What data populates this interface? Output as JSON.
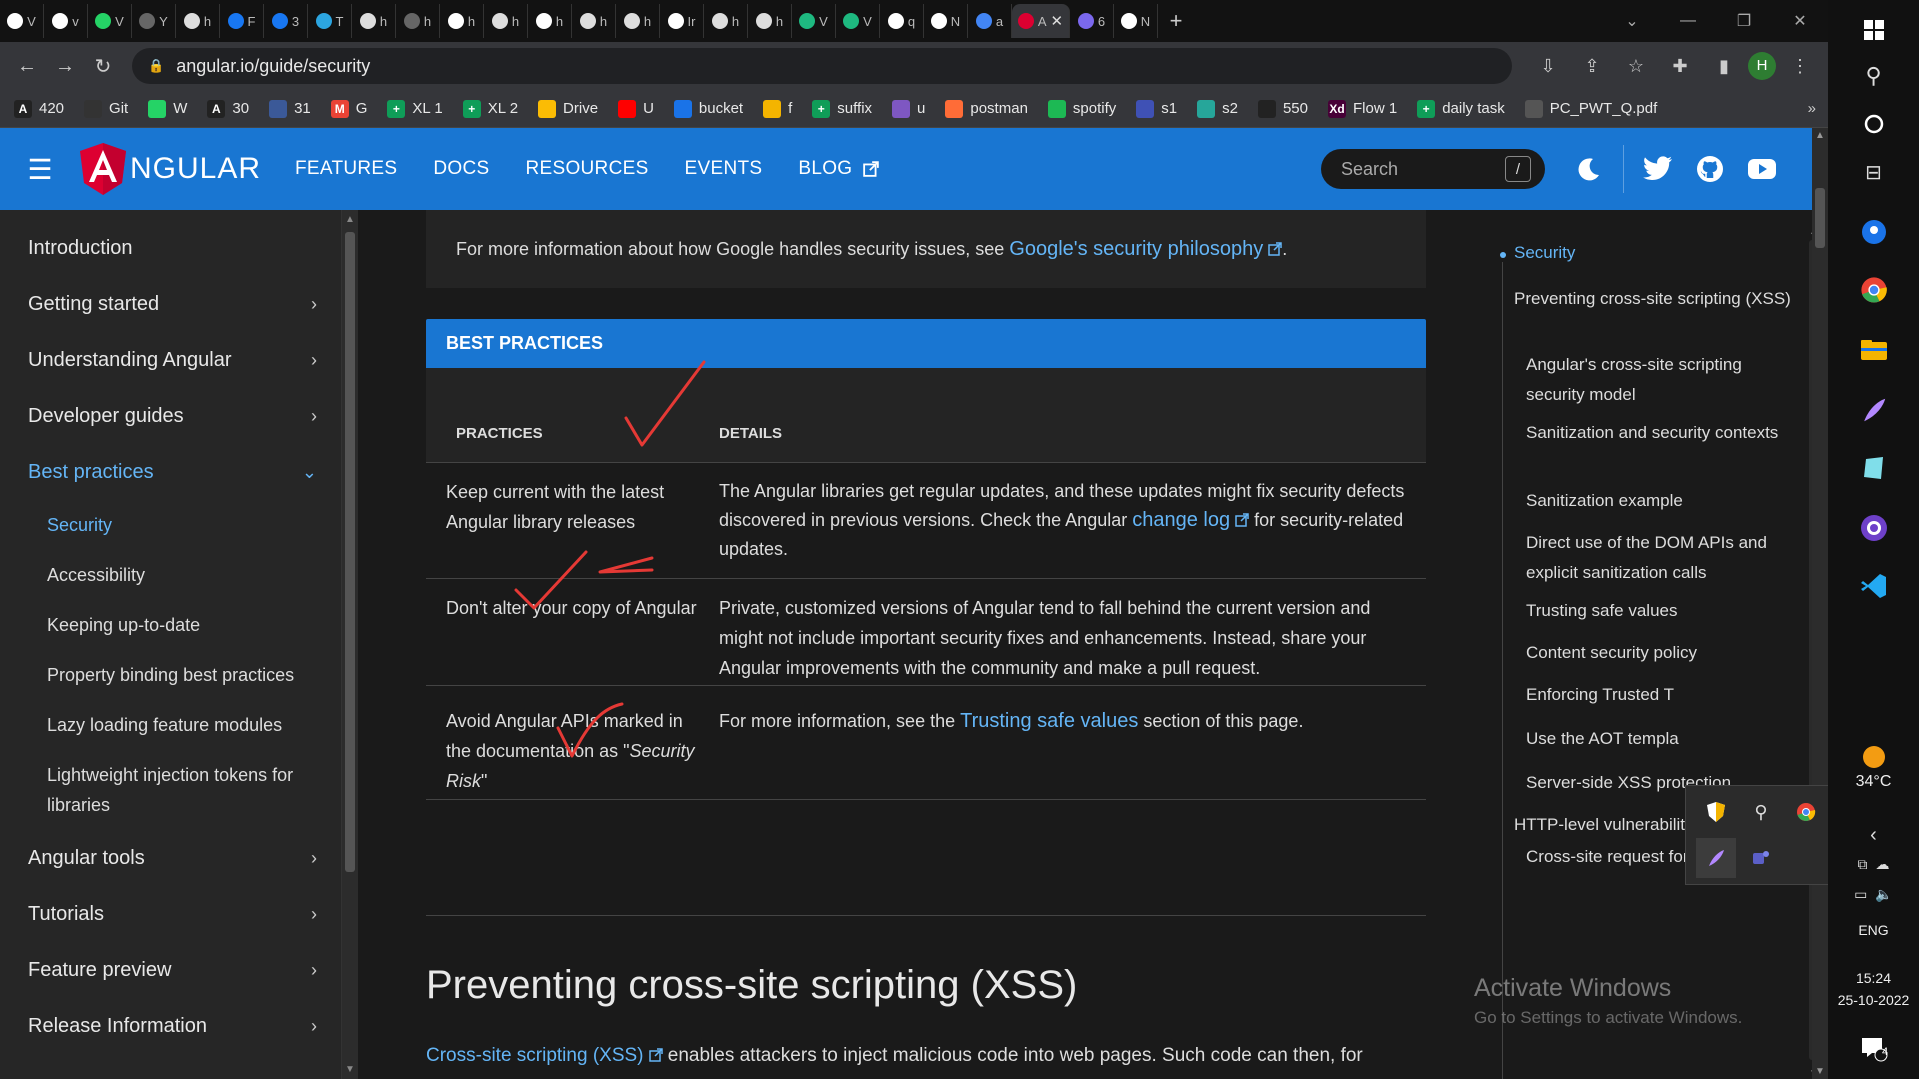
{
  "tabs": [
    {
      "label": "V",
      "color": "#ffffff"
    },
    {
      "label": "v",
      "color": "#ffffff"
    },
    {
      "label": "V",
      "color": "#25d366"
    },
    {
      "label": "Y",
      "color": "#666666"
    },
    {
      "label": "h",
      "color": "#dddddd"
    },
    {
      "label": "F",
      "color": "#1877f2"
    },
    {
      "label": "3",
      "color": "#1877f2"
    },
    {
      "label": "T",
      "color": "#2ca5e0"
    },
    {
      "label": "h",
      "color": "#dddddd"
    },
    {
      "label": "h",
      "color": "#666666"
    },
    {
      "label": "h",
      "color": "#ffffff"
    },
    {
      "label": "h",
      "color": "#dddddd"
    },
    {
      "label": "h",
      "color": "#ffffff"
    },
    {
      "label": "h",
      "color": "#dddddd"
    },
    {
      "label": "h",
      "color": "#dddddd"
    },
    {
      "label": "Ir",
      "color": "#ffffff"
    },
    {
      "label": "h",
      "color": "#dddddd"
    },
    {
      "label": "h",
      "color": "#dddddd"
    },
    {
      "label": "V",
      "color": "#1eb980"
    },
    {
      "label": "V",
      "color": "#1eb980"
    },
    {
      "label": "q",
      "color": "#ffffff"
    },
    {
      "label": "N",
      "color": "#ffffff"
    },
    {
      "label": "a",
      "color": "#4285f4"
    },
    {
      "label": "A",
      "color": "#dd0031",
      "active": true
    },
    {
      "label": "6",
      "color": "#7b68ee"
    },
    {
      "label": "N",
      "color": "#ffffff"
    }
  ],
  "url": "angular.io/guide/security",
  "profile_initial": "H",
  "bookmarks": [
    {
      "label": "420",
      "color": "#222222",
      "glyph": "A"
    },
    {
      "label": "Git",
      "color": "#333333",
      "glyph": ""
    },
    {
      "label": "W",
      "color": "#25d366",
      "glyph": ""
    },
    {
      "label": "30",
      "color": "#222222",
      "glyph": "A"
    },
    {
      "label": "31",
      "color": "#3b5998",
      "glyph": ""
    },
    {
      "label": "G",
      "color": "#ea4335",
      "glyph": "M"
    },
    {
      "label": "XL 1",
      "color": "#0f9d58",
      "glyph": "+"
    },
    {
      "label": "XL 2",
      "color": "#0f9d58",
      "glyph": "+"
    },
    {
      "label": "Drive",
      "color": "#fbbc04",
      "glyph": ""
    },
    {
      "label": "U",
      "color": "#ff0000",
      "glyph": ""
    },
    {
      "label": "bucket",
      "color": "#1a73e8",
      "glyph": ""
    },
    {
      "label": "f",
      "color": "#f4b400",
      "glyph": ""
    },
    {
      "label": "suffix",
      "color": "#0f9d58",
      "glyph": "+"
    },
    {
      "label": "u",
      "color": "#7e57c2",
      "glyph": ""
    },
    {
      "label": "postman",
      "color": "#ff6c37",
      "glyph": ""
    },
    {
      "label": "spotify",
      "color": "#1db954",
      "glyph": ""
    },
    {
      "label": "s1",
      "color": "#3f51b5",
      "glyph": ""
    },
    {
      "label": "s2",
      "color": "#26a69a",
      "glyph": ""
    },
    {
      "label": "550",
      "color": "#222222",
      "glyph": ""
    },
    {
      "label": "Flow 1",
      "color": "#470137",
      "glyph": "Xd"
    },
    {
      "label": "daily task",
      "color": "#0f9d58",
      "glyph": "+"
    },
    {
      "label": "PC_PWT_Q.pdf",
      "color": "#555555",
      "glyph": ""
    }
  ],
  "header": {
    "logo_text": "NGULAR",
    "nav": [
      "FEATURES",
      "DOCS",
      "RESOURCES",
      "EVENTS",
      "BLOG"
    ],
    "search_placeholder": "Search",
    "search_shortcut": "/"
  },
  "sidebar": {
    "items": [
      {
        "label": "Introduction",
        "chevron": ""
      },
      {
        "label": "Getting started",
        "chevron": "›"
      },
      {
        "label": "Understanding Angular",
        "chevron": "›"
      },
      {
        "label": "Developer guides",
        "chevron": "›"
      },
      {
        "label": "Best practices",
        "chevron": "⌄",
        "open": true
      }
    ],
    "subitems": [
      {
        "label": "Security",
        "active": true
      },
      {
        "label": "Accessibility"
      },
      {
        "label": "Keeping up-to-date"
      },
      {
        "label": "Property binding best practices"
      },
      {
        "label": "Lazy loading feature modules"
      },
      {
        "label": "Lightweight injection tokens for libraries"
      }
    ],
    "items_after": [
      {
        "label": "Angular tools",
        "chevron": "›"
      },
      {
        "label": "Tutorials",
        "chevron": "›"
      },
      {
        "label": "Feature preview",
        "chevron": "›"
      },
      {
        "label": "Release Information",
        "chevron": "›"
      }
    ]
  },
  "main": {
    "info_prefix": "For more information about how Google handles security issues, see ",
    "info_link": "Google's security philosophy",
    "info_suffix": ".",
    "table_title": "BEST PRACTICES",
    "col_practices": "PRACTICES",
    "col_details": "DETAILS",
    "rows": [
      {
        "practice": "Keep current with the latest Angular library releases",
        "d_before": "The Angular libraries get regular updates, and these updates might fix security defects discovered in previous versions. Check the Angular ",
        "d_link": "change log",
        "d_after": " for security-related updates."
      },
      {
        "practice": "Don't alter your copy of Angular",
        "d_before": "Private, customized versions of Angular tend to fall behind the current version and might not include important security fixes and enhancements. Instead, share your Angular improvements with the community and make a pull request.",
        "d_link": "",
        "d_after": ""
      },
      {
        "practice_before": "Avoid Angular APIs marked in the documentation as \"",
        "practice_em": "Security Risk",
        "practice_after": "\"",
        "d_before": "For more information, see the ",
        "d_link": "Trusting safe values",
        "d_after": " section of this page."
      }
    ],
    "xss_title": "Preventing cross-site scripting (XSS)",
    "xss_link": "Cross-site scripting (XSS)",
    "xss_text": " enables attackers to inject malicious code into web pages. Such code can then, for"
  },
  "toc": [
    {
      "label": "Security",
      "active": true
    },
    {
      "label": "Preventing cross-site scripting (XSS)"
    },
    {
      "label": "Angular's cross-site scripting security model"
    },
    {
      "label": "Sanitization and security contexts"
    },
    {
      "label": "Sanitization example"
    },
    {
      "label": "Direct use of the DOM APIs and explicit sanitization calls"
    },
    {
      "label": "Trusting safe values"
    },
    {
      "label": "Content security policy"
    },
    {
      "label": "Enforcing Trusted T"
    },
    {
      "label": "Use the AOT templa"
    },
    {
      "label": "Server-side XSS protection"
    },
    {
      "label": "HTTP-level vulnerabilities"
    },
    {
      "label": "Cross-site request forgery"
    }
  ],
  "watermark": {
    "line1": "Activate Windows",
    "line2": "Go to Settings to activate Windows."
  },
  "taskbar": {
    "temperature": "34°C",
    "language": "ENG",
    "time": "15:24",
    "date": "25-10-2022",
    "notifications": "4"
  },
  "colors": {
    "angular_blue": "#1976d2",
    "link": "#64b5f6",
    "angular_red": "#dd0031",
    "annotation": "#e53935"
  }
}
